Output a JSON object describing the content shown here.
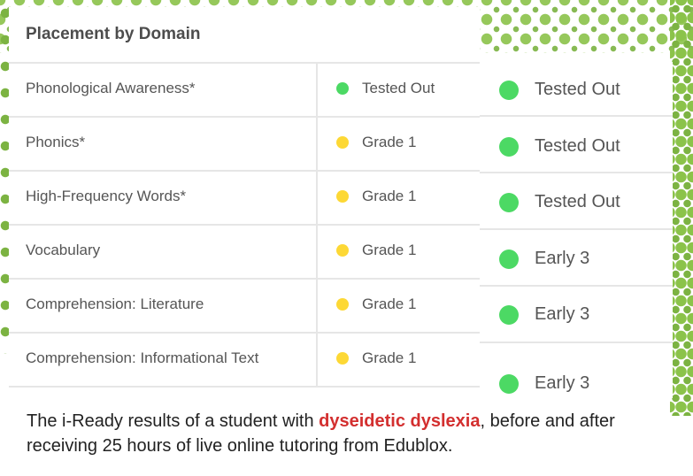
{
  "title": "Placement by Domain",
  "colors": {
    "tested_out": "#4cd964",
    "grade": "#fdd835",
    "pattern": "#7cb342",
    "highlight": "#d32f2f"
  },
  "before": [
    {
      "domain": "Phonological Awareness*",
      "status": "Tested Out",
      "color": "#4cd964"
    },
    {
      "domain": "Phonics*",
      "status": "Grade 1",
      "color": "#fdd835"
    },
    {
      "domain": "High-Frequency Words*",
      "status": "Grade 1",
      "color": "#fdd835"
    },
    {
      "domain": "Vocabulary",
      "status": "Grade 1",
      "color": "#fdd835"
    },
    {
      "domain": "Comprehension: Literature",
      "status": "Grade 1",
      "color": "#fdd835"
    },
    {
      "domain": "Comprehension: Informational Text",
      "status": "Grade 1",
      "color": "#fdd835"
    }
  ],
  "after": [
    {
      "status": "Tested Out"
    },
    {
      "status": "Tested Out"
    },
    {
      "status": "Tested Out"
    },
    {
      "status": "Early 3"
    },
    {
      "status": "Early 3"
    },
    {
      "status": "Early 3"
    }
  ],
  "caption": {
    "prefix": "The i-Ready results of a student with ",
    "highlight": "dyseidetic dyslexia",
    "suffix": ", before and after receiving 25 hours of live online tutoring from Edublox."
  }
}
